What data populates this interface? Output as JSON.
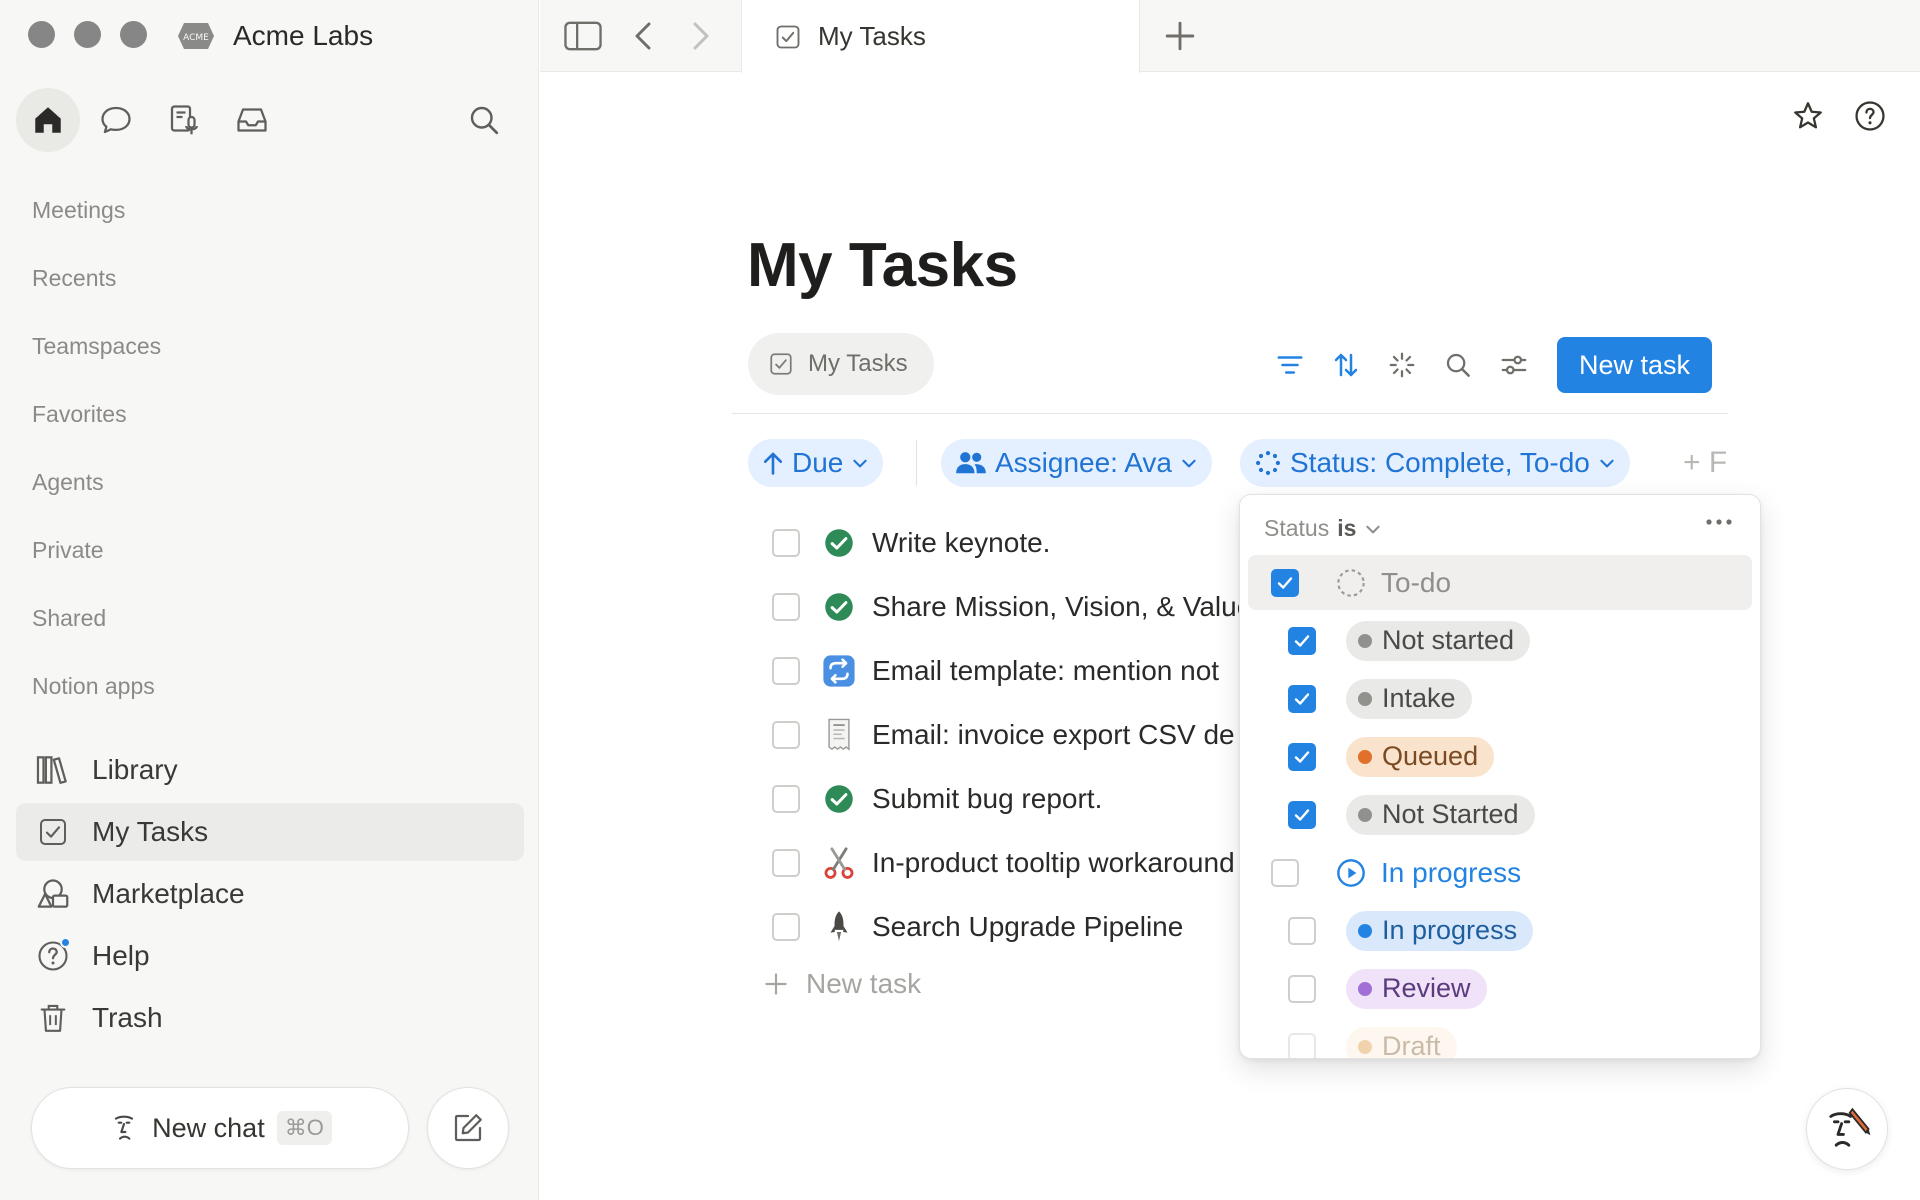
{
  "workspace": {
    "name": "Acme Labs",
    "logo_text": "ACME"
  },
  "sidebar": {
    "sections": [
      "Meetings",
      "Recents",
      "Teamspaces",
      "Favorites",
      "Agents",
      "Private",
      "Shared",
      "Notion apps"
    ],
    "items": [
      {
        "label": "Library",
        "icon": "library-icon"
      },
      {
        "label": "My Tasks",
        "icon": "checkbox-icon",
        "active": true
      },
      {
        "label": "Marketplace",
        "icon": "marketplace-icon"
      },
      {
        "label": "Help",
        "icon": "help-icon",
        "notification": true
      },
      {
        "label": "Trash",
        "icon": "trash-icon"
      }
    ],
    "new_chat": {
      "label": "New chat",
      "shortcut": "⌘O"
    }
  },
  "tabs": {
    "active_label": "My Tasks"
  },
  "page": {
    "title": "My Tasks",
    "view_tab": "My Tasks",
    "new_task_button": "New task",
    "new_task_row": "New task"
  },
  "filters": {
    "sort": "Due",
    "assignee": "Assignee: Ava",
    "status": "Status: Complete, To-do",
    "add": "+ F"
  },
  "tasks": [
    {
      "label": "Write keynote.",
      "icon": "check-circle-icon"
    },
    {
      "label": "Share Mission, Vision, & Values",
      "icon": "check-circle-icon"
    },
    {
      "label": "Email template: mention not",
      "icon": "repeat-icon"
    },
    {
      "label": "Email: invoice export CSV de",
      "icon": "receipt-icon"
    },
    {
      "label": "Submit bug report.",
      "icon": "check-circle-icon"
    },
    {
      "label": "In-product tooltip workaround",
      "icon": "scissors-icon"
    },
    {
      "label": "Search Upgrade Pipeline",
      "icon": "rocket-icon"
    }
  ],
  "status_dropdown": {
    "header_key": "Status",
    "header_op": "is",
    "options": [
      {
        "label": "To-do",
        "checked": true,
        "kind": "group"
      },
      {
        "label": "Not started",
        "checked": true,
        "kind": "pill",
        "color": "#91918e",
        "bg": "#e9e9e7",
        "text": "#4a4946"
      },
      {
        "label": "Intake",
        "checked": true,
        "kind": "pill",
        "color": "#91918e",
        "bg": "#e9e9e7",
        "text": "#4a4946"
      },
      {
        "label": "Queued",
        "checked": true,
        "kind": "pill",
        "color": "#e0702c",
        "bg": "#fae3cc",
        "text": "#7a4a22"
      },
      {
        "label": "Not Started",
        "checked": true,
        "kind": "pill",
        "color": "#91918e",
        "bg": "#e9e9e7",
        "text": "#4a4946"
      },
      {
        "label": "In progress",
        "checked": false,
        "kind": "group"
      },
      {
        "label": "In progress",
        "checked": false,
        "kind": "pill",
        "color": "#2383e2",
        "bg": "#d9e9fb",
        "text": "#1f5e9e"
      },
      {
        "label": "Review",
        "checked": false,
        "kind": "pill",
        "color": "#a26fd6",
        "bg": "#efe2f9",
        "text": "#5b3b7b"
      },
      {
        "label": "Draft",
        "checked": false,
        "kind": "pill",
        "color": "#e0a04c",
        "bg": "#fbefdc",
        "text": "#8a6a3f"
      }
    ]
  },
  "colors": {
    "accent": "#2383e2",
    "sidebar_bg": "#f7f7f5",
    "complete_green": "#2e8b57"
  }
}
